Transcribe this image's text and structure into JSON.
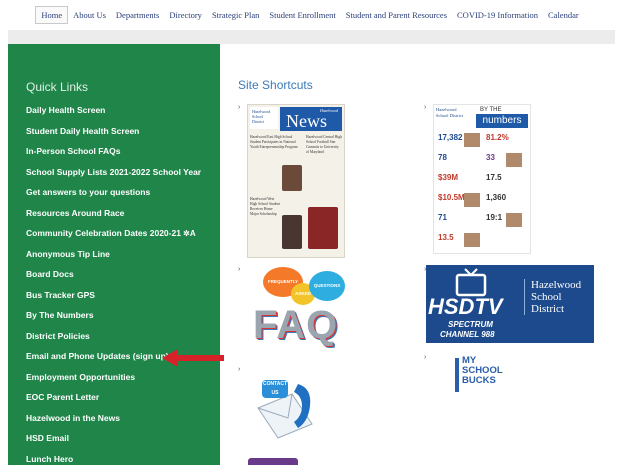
{
  "nav": {
    "items": [
      "Home",
      "About Us",
      "Departments",
      "Directory",
      "Strategic Plan",
      "Student Enrollment",
      "Student and Parent Resources",
      "COVID-19 Information",
      "Calendar"
    ],
    "active_index": 0
  },
  "sidebar": {
    "title": "Quick Links",
    "items": [
      "Daily Health Screen",
      "Student Daily Health Screen",
      "In-Person School FAQs",
      "School Supply Lists 2021-2022 School Year",
      "Get answers to your questions",
      "Resources Around Race",
      "Community Celebration Dates 2020-21",
      "Anonymous Tip Line",
      "Board Docs",
      "Bus Tracker GPS",
      "By The Numbers",
      "District Policies",
      "Email and Phone Updates (sign up)",
      "Employment Opportunities",
      "EOC Parent Letter",
      "Hazelwood in the News",
      "HSD Email",
      "Lunch Hero"
    ],
    "celebration_icon": "translate-icon"
  },
  "main": {
    "title": "Site Shortcuts",
    "bullet": "›",
    "news": {
      "logo": "Hazelwood School District",
      "masthead_small": "Hazelwood",
      "masthead": "News",
      "stories": [
        "Hazelwood East High School Student Participates in National Youth Entrepreneurship Program",
        "Hazelwood Central High School Football Star Commits to University of Maryland",
        "Hazelwood West High School Student Receives Home Major Scholarship"
      ]
    },
    "numbers": {
      "logo": "Hazelwood School District",
      "by_the": "BY THE",
      "heading": "numbers",
      "stats": [
        "17,382",
        "81.2%",
        "78",
        "33",
        "$39M",
        "17.5",
        "$10.5M",
        "1,360",
        "71",
        "19:1",
        "13.5"
      ]
    },
    "faq": {
      "bubbles": [
        "FREQUENTLY",
        "ASKED",
        "QUESTIONS"
      ],
      "text": "FAQ"
    },
    "hsdtv": {
      "brand": "HSDTV",
      "line1": "SPECTRUM",
      "line2": "CHANNEL 988",
      "district": [
        "Hazelwood",
        "School",
        "District"
      ]
    },
    "contact": {
      "text": "CONTACT US"
    },
    "bucks": {
      "lines": [
        "MY",
        "SCHOOL",
        "BUCKS"
      ]
    }
  },
  "colors": {
    "sidebar": "#1f8549",
    "accent": "#3a7bb8",
    "arrow": "#d6232a",
    "nav_text": "#2a3f7a",
    "hsdtv": "#1d4a8c"
  }
}
